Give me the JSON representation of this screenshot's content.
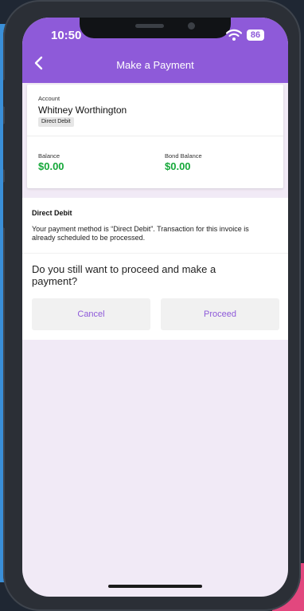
{
  "status_bar": {
    "time": "10:50",
    "battery": "86"
  },
  "header": {
    "title": "Make a Payment"
  },
  "account": {
    "label": "Account",
    "name": "Whitney Worthington",
    "payment_method_badge": "Direct Debit",
    "balance_label": "Balance",
    "balance_value": "$0.00",
    "bond_balance_label": "Bond Balance",
    "bond_balance_value": "$0.00"
  },
  "direct_debit": {
    "title": "Direct Debit",
    "message": "Your payment method is “Direct Debit”. Transaction for this invoice is already scheduled to be processed.",
    "question": "Do you still want to proceed and make a payment?"
  },
  "actions": {
    "cancel_label": "Cancel",
    "proceed_label": "Proceed"
  },
  "colors": {
    "accent": "#8e5ad9",
    "balance_green": "#16a83a",
    "screen_background": "#f1eaf6"
  },
  "icons": {
    "back": "chevron-left-icon",
    "wifi": "wifi-icon"
  }
}
